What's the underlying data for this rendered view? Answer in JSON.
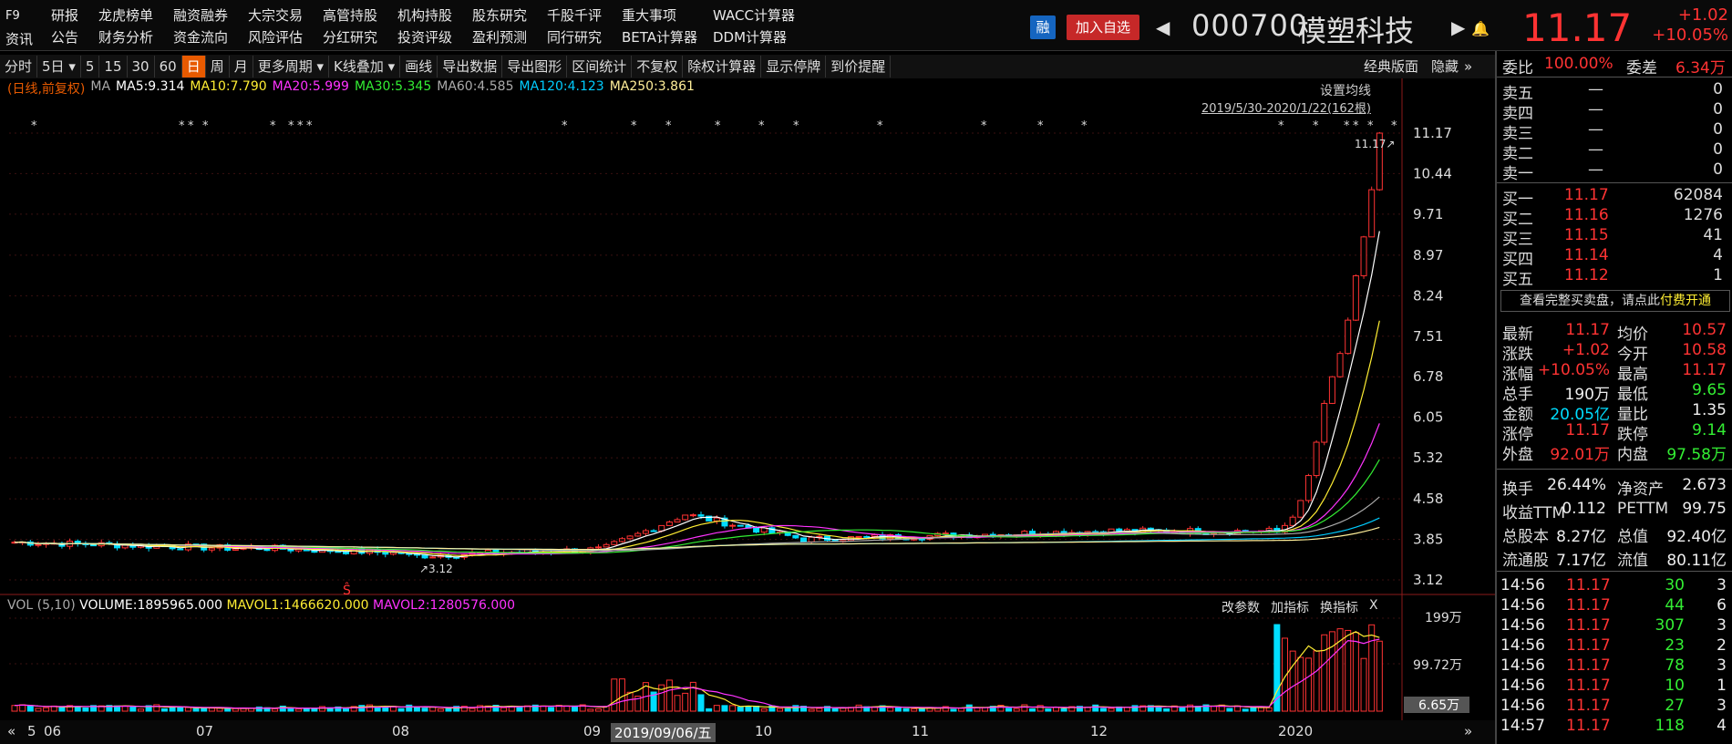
{
  "menu": {
    "f9": "F9",
    "zixun": "资讯",
    "row1": [
      "研报",
      "龙虎榜单",
      "融资融券",
      "大宗交易",
      "高管持股",
      "机构持股",
      "股东研究",
      "千股千评",
      "重大事项",
      "WACC计算器"
    ],
    "row2": [
      "公告",
      "财务分析",
      "资金流向",
      "风险评估",
      "分红研究",
      "投资评级",
      "盈利预测",
      "同行研究",
      "BETA计算器",
      "DDM计算器"
    ]
  },
  "header": {
    "rong": "融",
    "add_fav": "加入自选",
    "code": "000700",
    "name": "模塑科技",
    "price": "11.17",
    "change": "+1.02",
    "change_pct": "+10.05%",
    "color_up": "#ff3333",
    "color_down": "#33ee33"
  },
  "toolbar": {
    "items": [
      "分时",
      "5日",
      "5",
      "15",
      "30",
      "60",
      "日",
      "周",
      "月",
      "更多周期",
      "K线叠加",
      "画线",
      "导出数据",
      "导出图形",
      "区间统计",
      "不复权",
      "除权计算器",
      "显示停牌",
      "到价提醒"
    ],
    "active": "日",
    "right_items": [
      "经典版面",
      "隐藏"
    ]
  },
  "ma_legend": {
    "label": "(日线,前复权)",
    "ma": "MA",
    "ma5": "MA5:9.314",
    "ma10": "MA10:7.790",
    "ma20": "MA20:5.999",
    "ma30": "MA30:5.345",
    "ma60": "MA60:4.585",
    "ma120": "MA120:4.123",
    "ma250": "MA250:3.861",
    "setting": "设置均线",
    "range": "2019/5/30-2020/1/22(162根)"
  },
  "chart_data": {
    "type": "candlestick",
    "y_ticks": [
      "11.17",
      "10.44",
      "9.71",
      "8.97",
      "8.24",
      "7.51",
      "6.78",
      "6.05",
      "5.32",
      "4.58",
      "3.85",
      "3.12"
    ],
    "ylim": [
      3.12,
      11.17
    ],
    "x_labels": [
      "5",
      "06",
      "07",
      "08",
      "09",
      "2019/09/06/五",
      "10",
      "11",
      "12",
      "2020"
    ],
    "high_label": "11.17",
    "low_label": "3.12",
    "close_recent": [
      3.98,
      4.1,
      4.25,
      4.55,
      5.0,
      5.6,
      6.3,
      6.78,
      7.2,
      7.8,
      8.6,
      9.3,
      10.15,
      11.17
    ],
    "vol": {
      "label": "VOL (5,10)",
      "volume": "VOLUME:1895965.000",
      "mavol1": "MAVOL1:1466620.000",
      "mavol2": "MAVOL2:1280576.000",
      "y_ticks": [
        "199万",
        "99.72万"
      ],
      "current": "6.65万",
      "buttons": [
        "改参数",
        "加指标",
        "换指标",
        "X"
      ]
    }
  },
  "panel": {
    "weibi_label": "委比",
    "weibi": "100.00%",
    "weicha_label": "委差",
    "weicha": "6.34万",
    "asks": [
      {
        "label": "卖五",
        "price": "—",
        "vol": "0"
      },
      {
        "label": "卖四",
        "price": "—",
        "vol": "0"
      },
      {
        "label": "卖三",
        "price": "—",
        "vol": "0"
      },
      {
        "label": "卖二",
        "price": "—",
        "vol": "0"
      },
      {
        "label": "卖一",
        "price": "—",
        "vol": "0"
      }
    ],
    "bids": [
      {
        "label": "买一",
        "price": "11.17",
        "vol": "62084"
      },
      {
        "label": "买二",
        "price": "11.16",
        "vol": "1276"
      },
      {
        "label": "买三",
        "price": "11.15",
        "vol": "41"
      },
      {
        "label": "买四",
        "price": "11.14",
        "vol": "4"
      },
      {
        "label": "买五",
        "price": "11.12",
        "vol": "1"
      }
    ],
    "full_book": "查看完整买卖盘，请点此",
    "pay": "付费开通",
    "quote": [
      {
        "l1": "最新",
        "v1": "11.17",
        "c1": "red",
        "l2": "均价",
        "v2": "10.57",
        "c2": "red"
      },
      {
        "l1": "涨跌",
        "v1": "+1.02",
        "c1": "red",
        "l2": "今开",
        "v2": "10.58",
        "c2": "red"
      },
      {
        "l1": "涨幅",
        "v1": "+10.05%",
        "c1": "red",
        "l2": "最高",
        "v2": "11.17",
        "c2": "red"
      },
      {
        "l1": "总手",
        "v1": "190万",
        "c1": "white",
        "l2": "最低",
        "v2": "9.65",
        "c2": "green"
      },
      {
        "l1": "金额",
        "v1": "20.05亿",
        "c1": "cyan",
        "l2": "量比",
        "v2": "1.35",
        "c2": "white"
      },
      {
        "l1": "涨停",
        "v1": "11.17",
        "c1": "red",
        "l2": "跌停",
        "v2": "9.14",
        "c2": "green"
      },
      {
        "l1": "外盘",
        "v1": "92.01万",
        "c1": "red",
        "l2": "内盘",
        "v2": "97.58万",
        "c2": "green"
      }
    ],
    "fund": [
      {
        "l1": "换手",
        "v1": "26.44%",
        "l2": "净资产",
        "v2": "2.673"
      },
      {
        "l1": "收益TTM",
        "v1": "0.112",
        "l2": "PETTM",
        "v2": "99.75"
      },
      {
        "l1": "总股本",
        "v1": "8.27亿",
        "l2": "总值",
        "v2": "92.40亿"
      },
      {
        "l1": "流通股",
        "v1": "7.17亿",
        "l2": "流值",
        "v2": "80.11亿"
      }
    ],
    "ticks": [
      {
        "t": "14:56",
        "p": "11.17",
        "v": "30",
        "n": "3"
      },
      {
        "t": "14:56",
        "p": "11.17",
        "v": "44",
        "n": "6"
      },
      {
        "t": "14:56",
        "p": "11.17",
        "v": "307",
        "n": "3"
      },
      {
        "t": "14:56",
        "p": "11.17",
        "v": "23",
        "n": "2"
      },
      {
        "t": "14:56",
        "p": "11.17",
        "v": "78",
        "n": "3"
      },
      {
        "t": "14:56",
        "p": "11.17",
        "v": "10",
        "n": "1"
      },
      {
        "t": "14:56",
        "p": "11.17",
        "v": "27",
        "n": "3"
      },
      {
        "t": "14:57",
        "p": "11.17",
        "v": "118",
        "n": "4"
      }
    ]
  }
}
